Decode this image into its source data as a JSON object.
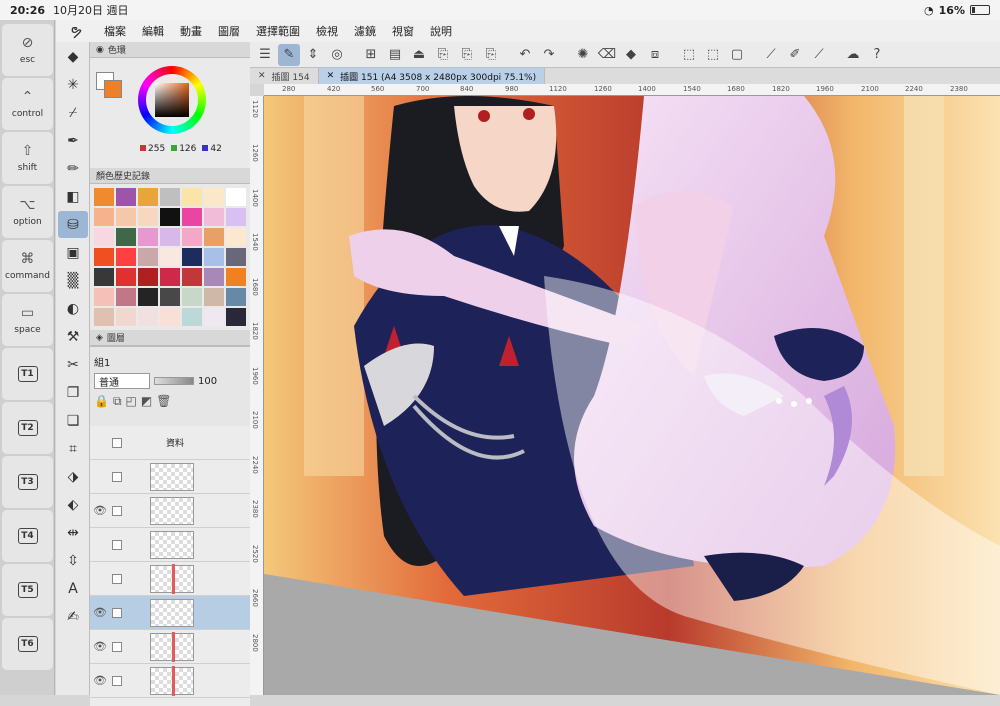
{
  "status": {
    "time": "20:26",
    "date": "10月20日 週日",
    "battery": "16%"
  },
  "edge_keys": [
    {
      "label": "esc",
      "glyph": "⊘"
    },
    {
      "label": "control",
      "glyph": "⌃"
    },
    {
      "label": "shift",
      "glyph": "⇧"
    },
    {
      "label": "option",
      "glyph": "⌥"
    },
    {
      "label": "command",
      "glyph": "⌘"
    },
    {
      "label": "space",
      "glyph": "▭"
    },
    {
      "label": "T1"
    },
    {
      "label": "T2"
    },
    {
      "label": "T3"
    },
    {
      "label": "T4"
    },
    {
      "label": "T5"
    },
    {
      "label": "T6"
    }
  ],
  "menu": [
    "檔案",
    "編輯",
    "動畫",
    "圖層",
    "選擇範圍",
    "檢視",
    "濾鏡",
    "視窗",
    "說明"
  ],
  "color_panel": {
    "title": "色環",
    "r": "255",
    "g": "126",
    "b": "42",
    "history_title": "顏色歷史記錄"
  },
  "layers_panel": {
    "title": "圖層",
    "blend_mode": "普通",
    "opacity": "100",
    "group_label": "組1"
  },
  "tabs": [
    {
      "label": "插圖 154",
      "active": false
    },
    {
      "label": "插圖 151 (A4 3508 x 2480px 300dpi 75.1%)",
      "active": true
    }
  ],
  "ruler_top": [
    "280",
    "420",
    "560",
    "700",
    "840",
    "980",
    "1120",
    "1260",
    "1400",
    "1540",
    "1680",
    "1820",
    "1960",
    "2100",
    "2240",
    "2380"
  ],
  "ruler_left": [
    "1120",
    "1260",
    "1400",
    "1540",
    "1680",
    "1820",
    "1960",
    "2100",
    "2240",
    "2380",
    "2520",
    "2660",
    "2800"
  ],
  "layer_label": "資料"
}
